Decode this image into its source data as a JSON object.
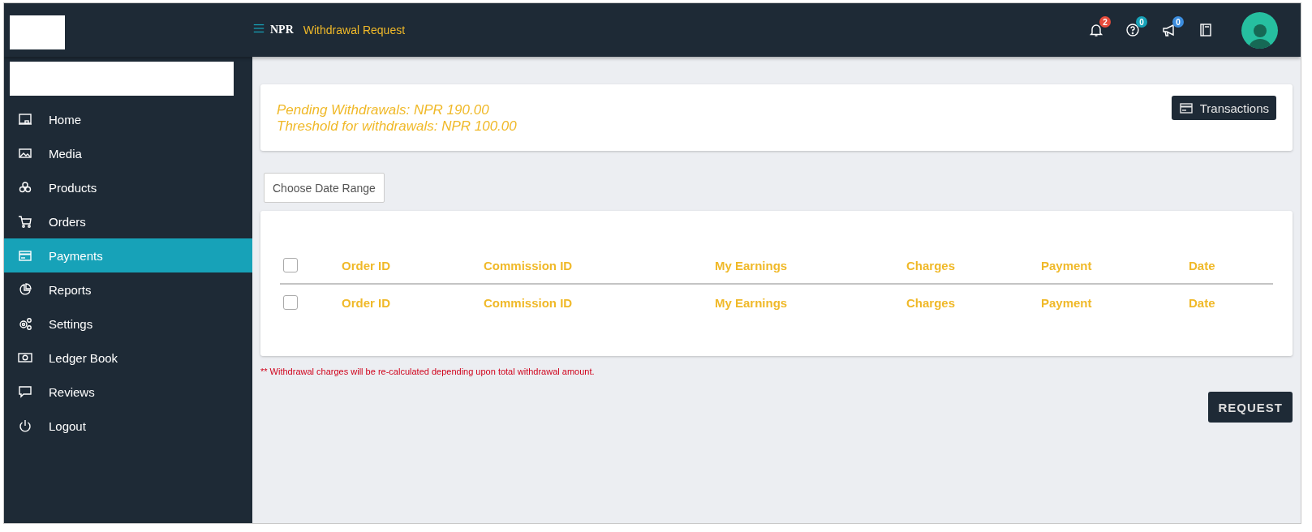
{
  "header": {
    "brand": "NPR",
    "title": "Withdrawal Request",
    "notifications": [
      {
        "kind": "bell",
        "count": "2",
        "color": "#e74c3c"
      },
      {
        "kind": "help",
        "count": "0",
        "color": "#17a2b8"
      },
      {
        "kind": "megaphone",
        "count": "0",
        "color": "#3c8dde"
      },
      {
        "kind": "book"
      }
    ]
  },
  "sidebar": {
    "items": [
      {
        "kind": "home",
        "label": "Home",
        "selected": false
      },
      {
        "kind": "media",
        "label": "Media",
        "selected": false
      },
      {
        "kind": "products",
        "label": "Products",
        "selected": false
      },
      {
        "kind": "orders",
        "label": "Orders",
        "selected": false
      },
      {
        "kind": "payments",
        "label": "Payments",
        "selected": true
      },
      {
        "kind": "reports",
        "label": "Reports",
        "selected": false
      },
      {
        "kind": "settings",
        "label": "Settings",
        "selected": false
      },
      {
        "kind": "ledger",
        "label": "Ledger Book",
        "selected": false
      },
      {
        "kind": "reviews",
        "label": "Reviews",
        "selected": false
      },
      {
        "kind": "logout",
        "label": "Logout",
        "selected": false
      }
    ]
  },
  "summary": {
    "lines": [
      "Pending Withdrawals: NPR 190.00",
      "Threshold for withdrawals: NPR 100.00"
    ],
    "button": "Transactions"
  },
  "date_range": {
    "label": "Choose Date Range"
  },
  "table": {
    "header": {
      "checked": false,
      "cells": [
        "Order ID",
        "Commission ID",
        "My Earnings",
        "Charges",
        "Payment",
        "Date"
      ]
    },
    "footer": {
      "checked": false,
      "cells": [
        "Order ID",
        "Commission ID",
        "My Earnings",
        "Charges",
        "Payment",
        "Date"
      ]
    }
  },
  "note": "** Withdrawal charges will be re-calculated depending upon total withdrawal amount.",
  "request_button": "REQUEST"
}
